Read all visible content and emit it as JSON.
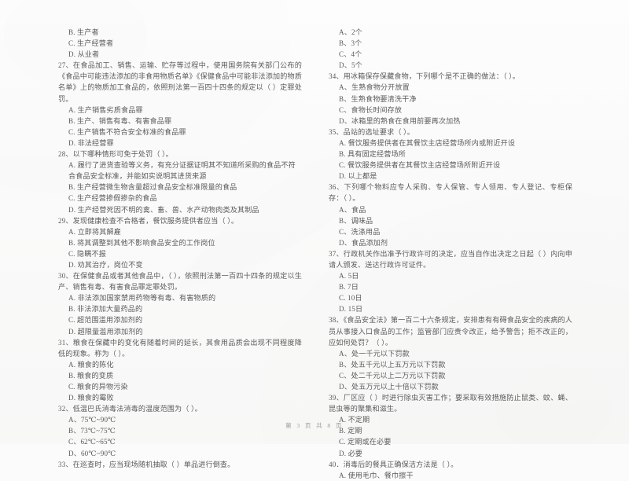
{
  "document": {
    "kind": "scanned-exam-paper",
    "footer": "第 3 页 共 8 页"
  },
  "columns": {
    "left": [
      {
        "id": "q26-tail",
        "number": "",
        "stem": "",
        "options": [
          "B. 生产者",
          "C. 生产经营者",
          "D. 从业者"
        ]
      },
      {
        "id": "q27",
        "number": "27、",
        "stem": "27、在食品加工、销售、运输、贮存等过程中，使用国务院有关部门公布的《食品中可能违法添加的非食用物质名单》《保健食品中可能非法添加的物质名单》上的物质加工食品的，依照刑法第一百四十四条的规定以（      ）定罪处罚。",
        "options": [
          "A. 生产销售劣质食品罪",
          "B. 生产、销售有毒、有害食品罪",
          "C. 生产销售不符合安全标准的食品罪",
          "D. 非法经营罪"
        ]
      },
      {
        "id": "q28",
        "number": "28、",
        "stem": "28、以下哪种情形可免于处罚（      ）。",
        "options": [
          "A. 履行了进货查验等义务，有充分证据证明其不知道所采购的食品不符合食品安全标准，并能如实说明其进货来源",
          "B. 生产经营微生物含量超过食品安全标准限量的食品",
          "C. 生产经营掺假掺杂的食品",
          "D. 生产经营死因不明的禽、畜、兽、水产动物肉类及其制品"
        ]
      },
      {
        "id": "q29",
        "number": "29、",
        "stem": "29、发现健康检查不合格者，餐饮服务提供者应当（      ）。",
        "options": [
          "A. 立即将其解雇",
          "B. 将其调整到其他不影响食品安全的工作岗位",
          "C. 隐瞒不报",
          "D. 劝其治疗，岗位不变"
        ]
      },
      {
        "id": "q30",
        "number": "30、",
        "stem": "30、在保健食品或者其他食品中，（      ），依照刑法第一百四十四条的规定以生产、销售有毒、有害食品罪定罪处罚。",
        "options": [
          "A. 非法添加国家禁用药物等有毒、有害物质的",
          "B. 非法添加大量药品的",
          "C. 超范围滥用添加剂的",
          "D. 超限量滥用添加剂的"
        ]
      },
      {
        "id": "q31",
        "number": "31、",
        "stem": "31、粮食在保藏中的变化有随着时间的延长，其食用品质会出现不同程度降低的现象。称为（      ）。",
        "options": [
          "A. 粮食的陈化",
          "B. 粮食的变质",
          "C. 粮食的异物污染",
          "D. 粮食的霉败"
        ]
      },
      {
        "id": "q32",
        "number": "32、",
        "stem": "32、低温巴氏消毒法消毒的温度范围为（      ）。",
        "options": [
          "A、75℃~90℃",
          "B、73℃~75℃",
          "C、62℃~65℃",
          "D、60℃~90℃"
        ]
      },
      {
        "id": "q33",
        "number": "33、",
        "stem": "33、在巡查时，应当现场随机抽取（      ）单品进行倒查。",
        "options": []
      }
    ],
    "right": [
      {
        "id": "q33-tail",
        "number": "",
        "stem": "",
        "options": [
          "A、2个",
          "B、3个",
          "C、4个",
          "D、5个"
        ]
      },
      {
        "id": "q34",
        "number": "34、",
        "stem": "34、用冰箱保存保藏食物，下列哪个是不正确的做法：（      ）。",
        "options": [
          "A、生熟食物分开放置",
          "B、生熟食物要清洗干净",
          "C、食物长时间存放",
          "D、冰箱里的熟食在食用前要再次加热"
        ]
      },
      {
        "id": "q35",
        "number": "35、",
        "stem": "35、品站的选址要求（      ）。",
        "options": [
          "A. 餐饮服务提供者在其餐饮主店经营场所内或附近开设",
          "B. 具有固定经营场所",
          "C. 餐饮服务提供者在其餐饮主店经营场所附近开设",
          "D. 以上都是"
        ]
      },
      {
        "id": "q36",
        "number": "36、",
        "stem": "36、下列哪个物料应专人采购、专人保管、专人领用、专人登记、专柜保存：（      ）。",
        "options": [
          "A、食品",
          "B、调味品",
          "C、洗涤用品",
          "D、食品添加剂"
        ]
      },
      {
        "id": "q37",
        "number": "37、",
        "stem": "37、行政机关作出准予行政许可的决定，应当自作出决定之日起（      ）内向申请人颁发、送达行政许可证件。",
        "options": [
          "A. 5日",
          "B. 7日",
          "C. 10日",
          "D. 15日"
        ]
      },
      {
        "id": "q38",
        "number": "38、",
        "stem": "38、《食品安全法》第一百二十六条规定，安排患有有碍食品安全的疾病的人员从事接入口食品的工作；监管部门应责令改正，给予警告；拒不改正的，应如何处罚？（      ）。",
        "options": [
          "A、处一千元以下罚款",
          "B、处五千元以上五万元以下罚款",
          "C、处二千元以上二万元以下罚款",
          "D、处五万元以上十倍以下罚款"
        ]
      },
      {
        "id": "q39",
        "number": "39、",
        "stem": "39、厂区应（      ）时进行除虫灭害工作；要采取有效措施防止鼠类、蚊、蝇、昆虫等的聚集和滋生。",
        "options": [
          "A. 不定期",
          "B. 定期",
          "C. 定期或在必要",
          "D. 必要"
        ]
      },
      {
        "id": "q40",
        "number": "40、",
        "stem": "40．消毒后的餐具正确保洁方法是（      ）。",
        "options": [
          "A. 使用毛巾、餐巾擦干"
        ]
      }
    ]
  }
}
